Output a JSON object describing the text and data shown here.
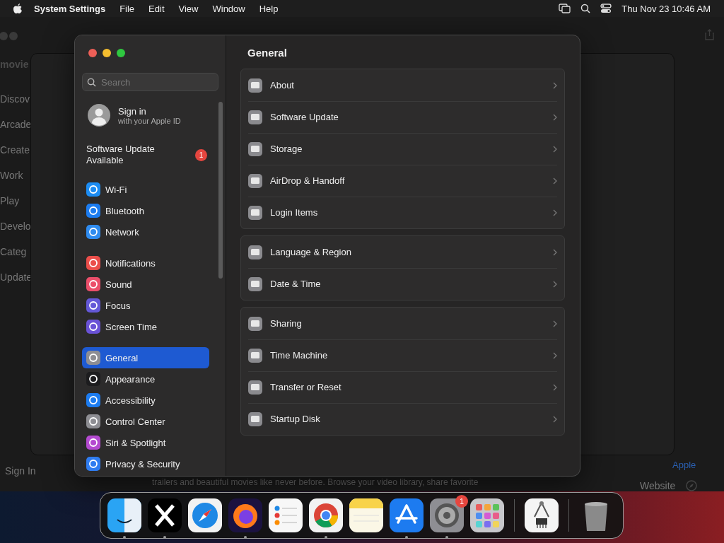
{
  "menu_bar": {
    "app_name": "System Settings",
    "menus": [
      "File",
      "Edit",
      "View",
      "Window",
      "Help"
    ],
    "clock": "Thu Nov 23 10:46 AM"
  },
  "background_window": {
    "title": "movie",
    "sidebar_items": [
      "Discov",
      "Arcade",
      "Create",
      "Work",
      "Play",
      "Develo",
      "Categ",
      "Update"
    ],
    "sign_in": "Sign In",
    "link": "Apple",
    "website": "Website",
    "description": "trailers and beautiful movies like never before. Browse your video library, share favorite"
  },
  "settings_window": {
    "sidebar": {
      "search": {
        "placeholder": "Search"
      },
      "account": {
        "title": "Sign in",
        "subtitle": "with your Apple ID"
      },
      "update": {
        "label": "Software Update Available",
        "badge": "1"
      },
      "groups": [
        [
          {
            "label": "Wi-Fi",
            "color": "#1c8cf2",
            "selected": false
          },
          {
            "label": "Bluetooth",
            "color": "#1c7cf0",
            "selected": false
          },
          {
            "label": "Network",
            "color": "#2f8cf0",
            "selected": false
          }
        ],
        [
          {
            "label": "Notifications",
            "color": "#eb4e4a",
            "selected": false
          },
          {
            "label": "Sound",
            "color": "#eb4e6a",
            "selected": false
          },
          {
            "label": "Focus",
            "color": "#6458d8",
            "selected": false
          },
          {
            "label": "Screen Time",
            "color": "#6a52d6",
            "selected": false
          }
        ],
        [
          {
            "label": "General",
            "color": "#8e8e93",
            "selected": true
          },
          {
            "label": "Appearance",
            "color": "#1c1c1e",
            "selected": false
          },
          {
            "label": "Accessibility",
            "color": "#1c7cf0",
            "selected": false
          },
          {
            "label": "Control Center",
            "color": "#8e8e93",
            "selected": false
          },
          {
            "label": "Siri & Spotlight",
            "color": "#b44ad0",
            "selected": false
          },
          {
            "label": "Privacy & Security",
            "color": "#2f7cf0",
            "selected": false
          }
        ]
      ]
    },
    "content": {
      "title": "General",
      "groups": [
        [
          "About",
          "Software Update",
          "Storage",
          "AirDrop & Handoff",
          "Login Items"
        ],
        [
          "Language & Region",
          "Date & Time"
        ],
        [
          "Sharing",
          "Time Machine",
          "Transfer or Reset",
          "Startup Disk"
        ]
      ]
    }
  },
  "dock": {
    "apps": [
      {
        "kind": "finder",
        "running": true
      },
      {
        "kind": "x",
        "running": true
      },
      {
        "kind": "safari",
        "running": false
      },
      {
        "kind": "firefox",
        "running": true
      },
      {
        "kind": "reminders",
        "running": false
      },
      {
        "kind": "chrome",
        "running": true
      },
      {
        "kind": "notes",
        "running": false
      },
      {
        "kind": "appstore",
        "running": true
      },
      {
        "kind": "settings",
        "running": true,
        "badge": "1"
      },
      {
        "kind": "launchpad",
        "running": false
      },
      {
        "kind": "separator"
      },
      {
        "kind": "tool",
        "running": false
      },
      {
        "kind": "separator"
      },
      {
        "kind": "trash",
        "running": false
      }
    ]
  }
}
